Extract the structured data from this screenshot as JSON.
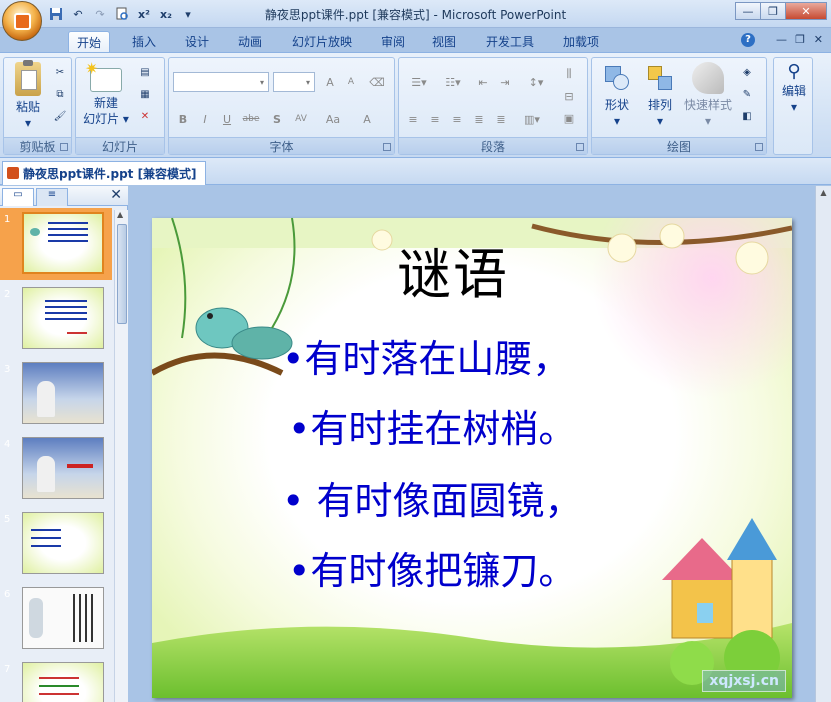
{
  "window": {
    "title": "静夜思ppt课件.ppt [兼容模式] - Microsoft PowerPoint",
    "buttons": [
      "minimize",
      "restore",
      "close"
    ]
  },
  "qat": {
    "icons": [
      "save-icon",
      "undo-icon",
      "redo-icon",
      "print-preview-icon",
      "superscript-icon",
      "subscript-icon",
      "customize-icon"
    ],
    "superscript": "x²",
    "subscript": "x₂"
  },
  "ribbon_tabs": [
    "开始",
    "插入",
    "设计",
    "动画",
    "幻灯片放映",
    "审阅",
    "视图",
    "开发工具",
    "加载项"
  ],
  "active_tab": "开始",
  "groups": {
    "clipboard": {
      "label": "剪贴板",
      "paste": "粘贴"
    },
    "slides": {
      "label": "幻灯片",
      "new_slide_line1": "新建",
      "new_slide_line2": "幻灯片"
    },
    "font": {
      "label": "字体",
      "bold": "B",
      "italic": "I",
      "underline": "U",
      "strike": "abe",
      "shadow": "S",
      "spacing": "AV",
      "case": "Aa",
      "color": "A",
      "grow": "A",
      "shrink": "A"
    },
    "paragraph": {
      "label": "段落"
    },
    "drawing": {
      "label": "绘图",
      "shapes": "形状",
      "arrange": "排列",
      "quick_styles": "快速样式"
    },
    "editing": {
      "label": "编辑",
      "edit": "编辑"
    }
  },
  "document_tab": "静夜思ppt课件.ppt [兼容模式]",
  "thumbnails": [
    {
      "num": "1",
      "selected": true
    },
    {
      "num": "2",
      "selected": false
    },
    {
      "num": "3",
      "selected": false
    },
    {
      "num": "4",
      "selected": false
    },
    {
      "num": "5",
      "selected": false
    },
    {
      "num": "6",
      "selected": false
    },
    {
      "num": "7",
      "selected": false
    }
  ],
  "slide": {
    "title": "谜语",
    "bullets": [
      "•有时落在山腰，",
      "•有时挂在树梢。",
      "• 有时像面圆镜，",
      "•有时像把镰刀。"
    ],
    "watermark": "xqjxsj.cn"
  },
  "colors": {
    "bullet_text": "#0000cc",
    "ribbon": "#d4e3f5",
    "selected_thumb": "#f6a24b"
  }
}
